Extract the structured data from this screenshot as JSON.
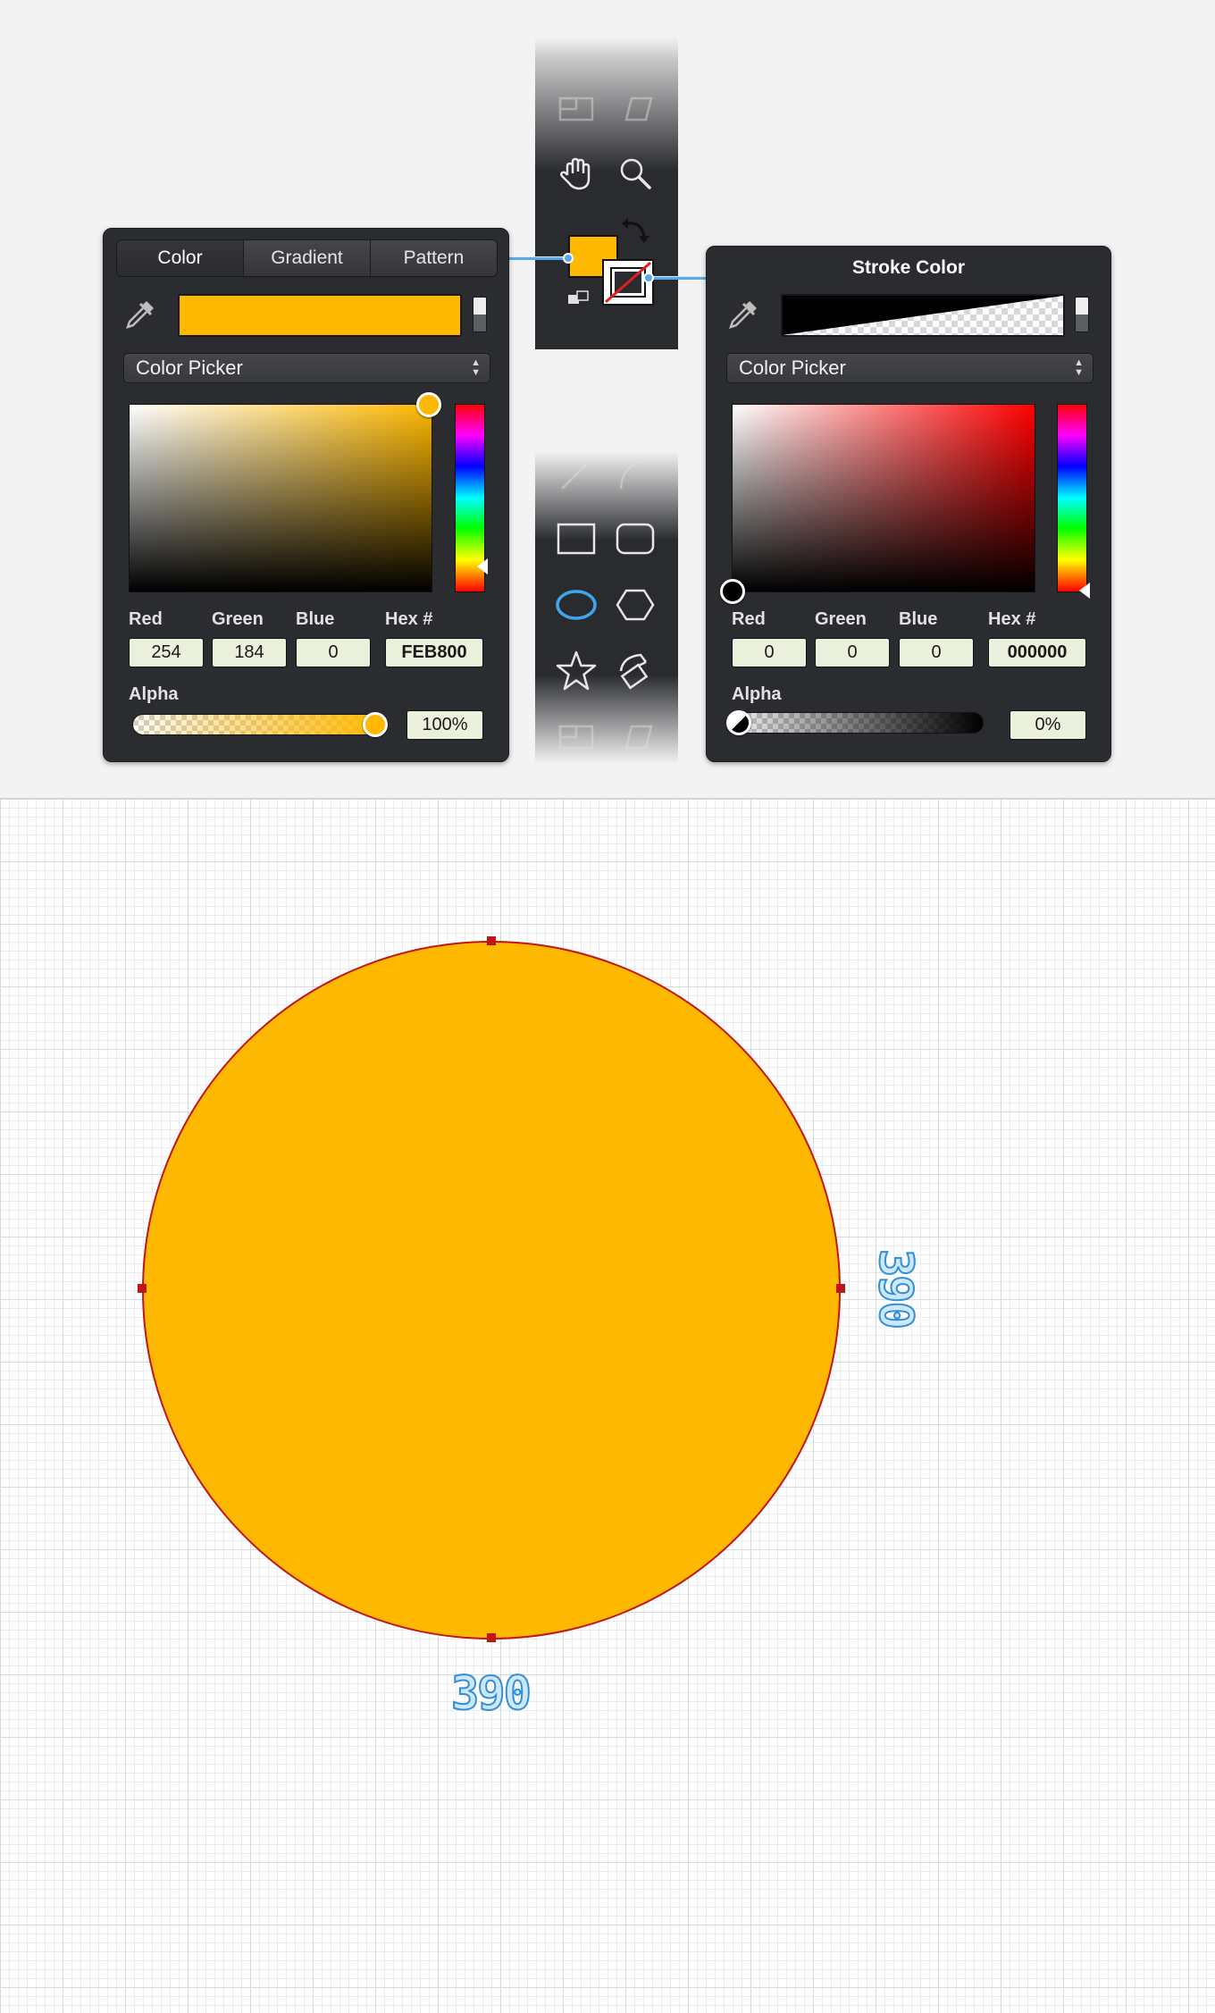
{
  "fill_panel": {
    "tabs": [
      "Color",
      "Gradient",
      "Pattern"
    ],
    "picker_mode": "Color Picker",
    "swatch_color": "#FEB800",
    "labels": {
      "red": "Red",
      "green": "Green",
      "blue": "Blue",
      "hex": "Hex #",
      "alpha": "Alpha"
    },
    "values": {
      "red": "254",
      "green": "184",
      "blue": "0",
      "hex": "FEB800",
      "alpha": "100%"
    },
    "alpha_level": 1.0
  },
  "stroke_panel": {
    "title": "Stroke Color",
    "picker_mode": "Color Picker",
    "labels": {
      "red": "Red",
      "green": "Green",
      "blue": "Blue",
      "hex": "Hex #",
      "alpha": "Alpha"
    },
    "values": {
      "red": "0",
      "green": "0",
      "blue": "0",
      "hex": "000000",
      "alpha": "0%"
    },
    "alpha_level": 0.0
  },
  "toolbar": {
    "tools_top": [
      "slice-tool-icon",
      "shear-tool-icon",
      "hand-tool-icon",
      "zoom-tool-icon",
      "swap-colors-icon",
      "default-colors-icon"
    ],
    "tools_shapes": [
      "line-tool-icon",
      "arc-tool-icon",
      "rectangle-tool-icon",
      "rounded-rectangle-tool-icon",
      "ellipse-tool-icon",
      "polygon-tool-icon",
      "star-tool-icon",
      "flare-tool-icon"
    ],
    "active_tool": "ellipse-tool-icon"
  },
  "canvas": {
    "shape": "circle",
    "fill_color": "#FEB800",
    "stroke_color": "#C0161B",
    "width_label": "390",
    "height_label": "390"
  }
}
